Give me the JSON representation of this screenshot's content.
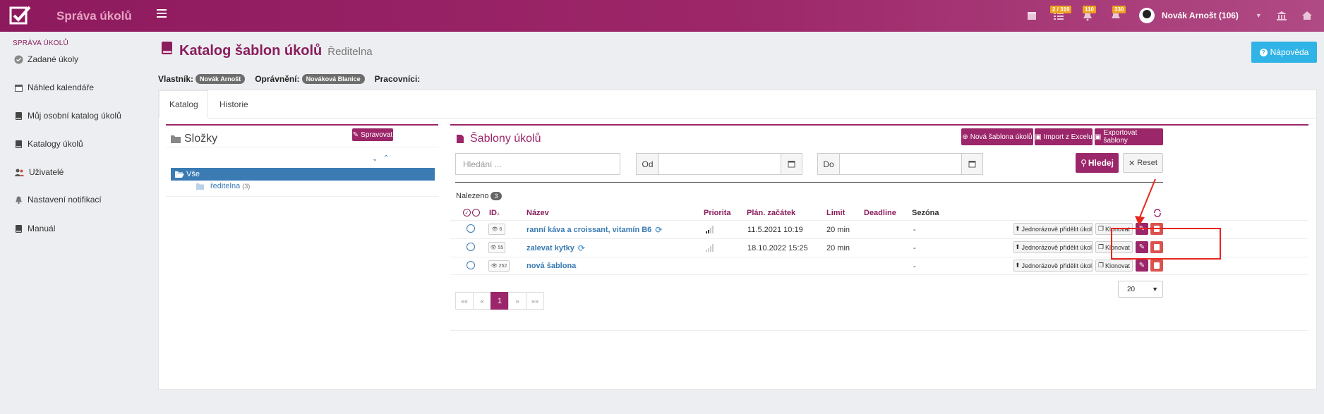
{
  "app": {
    "title": "Správa úkolů"
  },
  "topbar": {
    "badges": [
      "2 / 319",
      "110",
      "330"
    ],
    "user_name": "Novák Arnošt (106)"
  },
  "sidebar": {
    "heading": "SPRÁVA ÚKOLŮ",
    "items": [
      {
        "label": "Zadané úkoly",
        "icon": "check-circle-icon"
      },
      {
        "label": "Náhled kalendáře",
        "icon": "calendar-icon"
      },
      {
        "label": "Můj osobní katalog úkolů",
        "icon": "book-icon"
      },
      {
        "label": "Katalogy úkolů",
        "icon": "book-icon"
      },
      {
        "label": "Uživatelé",
        "icon": "users-icon"
      },
      {
        "label": "Nastavení notifikací",
        "icon": "bell-icon"
      },
      {
        "label": "Manuál",
        "icon": "book-icon"
      }
    ]
  },
  "page": {
    "title": "Katalog šablon úkolů",
    "subtitle": "Ředitelna",
    "help_label": "Nápověda"
  },
  "owners": {
    "owner_label": "Vlastník:",
    "owner": "Novák Arnošt",
    "rights_label": "Oprávnění:",
    "rights": "Nováková Blanice",
    "workers_label": "Pracovníci:"
  },
  "tabs": [
    "Katalog",
    "Historie"
  ],
  "folders": {
    "title": "Složky",
    "manage_label": "Spravovat",
    "tree": {
      "root": "Vše",
      "child": "ředitelna",
      "child_count": "(3)"
    }
  },
  "templates": {
    "title": "Šablony úkolů",
    "buttons": {
      "new": "Nová šablona úkolů",
      "import": "Import z Excelu",
      "export": "Exportovat šablony"
    },
    "search": {
      "placeholder": "Hledání ...",
      "from_label": "Od",
      "to_label": "Do",
      "search_label": "Hledej",
      "reset_label": "Reset"
    },
    "found_label": "Nalezeno",
    "found_count": "3",
    "columns": [
      "ID",
      "Název",
      "Priorita",
      "Plán. začátek",
      "Limit",
      "Deadline",
      "Sezóna"
    ],
    "rows": [
      {
        "id": "6",
        "name": "ranní káva a croissant, vitamín B6",
        "repeat": true,
        "priority": "high",
        "start": "11.5.2021 10:19",
        "limit": "20 min",
        "deadline": "",
        "season": "-"
      },
      {
        "id": "55",
        "name": "zalevat kytky",
        "repeat": true,
        "priority": "low",
        "start": "18.10.2022 15:25",
        "limit": "20 min",
        "deadline": "",
        "season": "-"
      },
      {
        "id": "252",
        "name": "nová šablona",
        "repeat": false,
        "priority": "",
        "start": "",
        "limit": "",
        "deadline": "",
        "season": "-"
      }
    ],
    "row_actions": {
      "assign": "Jednorázově přidělit úkol",
      "clone": "Klonovat"
    },
    "pager": [
      "««",
      "«",
      "1",
      "»",
      "»»"
    ],
    "per_page": "20"
  },
  "colors": {
    "brand": "#9b2669",
    "link": "#3a7bb4",
    "help": "#30b3e6",
    "danger": "#d9534f",
    "annotation": "#e8261e"
  }
}
